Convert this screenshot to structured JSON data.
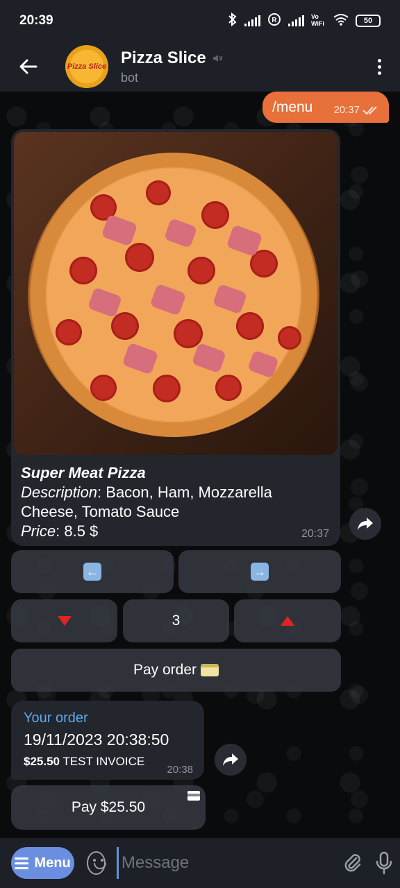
{
  "status_bar": {
    "time": "20:39",
    "battery": "50"
  },
  "header": {
    "title": "Pizza Slice",
    "subtitle": "bot",
    "avatar_text": "Pizza Slice"
  },
  "outgoing": {
    "text": "/menu",
    "time": "20:37"
  },
  "product": {
    "name": "Super Meat Pizza",
    "description_label": "Description",
    "description": ": Bacon, Ham, Mozzarella Cheese, Tomato Sauce",
    "price_label": "Price",
    "price": ": 8.5 $",
    "time": "20:37"
  },
  "keyboard": {
    "quantity": "3",
    "pay_label": "Pay order"
  },
  "invoice": {
    "title": "Your order",
    "date": "19/11/2023 20:38:50",
    "amount": "$25.50",
    "label": "TEST INVOICE",
    "time": "20:38",
    "pay_button": "Pay $25.50"
  },
  "input_bar": {
    "menu_label": "Menu",
    "placeholder": "Message"
  },
  "colors": {
    "accent": "#6b8fe0",
    "outgoing_bubble": "#e8703a",
    "link": "#5aaaf0"
  }
}
